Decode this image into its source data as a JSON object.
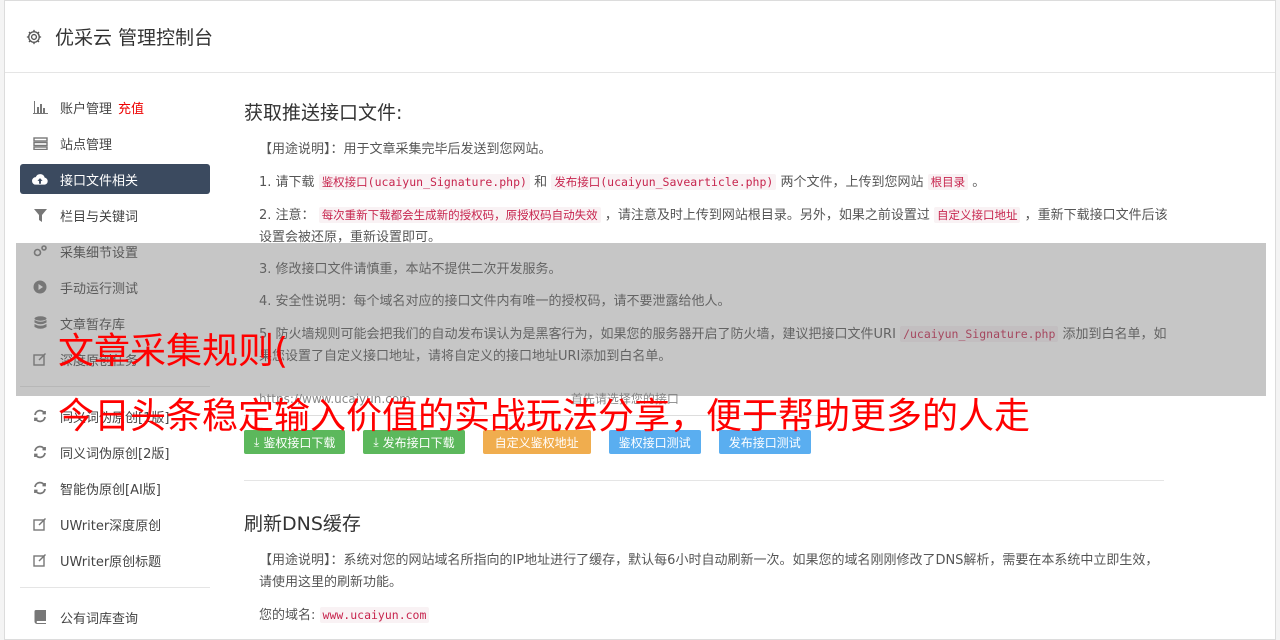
{
  "app": {
    "title": "优采云 管理控制台"
  },
  "sidebar": {
    "items": [
      {
        "label": "账户管理",
        "extra": "充值",
        "icon": "bar-chart-icon"
      },
      {
        "label": "站点管理",
        "icon": "server-icon"
      },
      {
        "label": "接口文件相关",
        "icon": "cloud-upload-icon",
        "active": true
      },
      {
        "label": "栏目与关键词",
        "icon": "filter-icon"
      },
      {
        "label": "采集细节设置",
        "icon": "cogs-icon"
      },
      {
        "label": "手动运行测试",
        "icon": "play-circle-icon"
      },
      {
        "label": "文章暂存库",
        "icon": "database-icon"
      },
      {
        "label": "深度原创任务",
        "icon": "edit-icon"
      },
      {
        "label": "同义词伪原创[1版]",
        "icon": "refresh-icon"
      },
      {
        "label": "同义词伪原创[2版]",
        "icon": "refresh-icon"
      },
      {
        "label": "智能伪原创[AI版]",
        "icon": "refresh-icon"
      },
      {
        "label": "UWriter深度原创",
        "icon": "edit-icon"
      },
      {
        "label": "UWriter原创标题",
        "icon": "edit-icon"
      },
      {
        "label": "公有词库查询",
        "icon": "book-icon"
      }
    ]
  },
  "section1": {
    "title": "获取推送接口文件:",
    "usage": "【用途说明】：用于文章采集完毕后发送到您网站。",
    "step1": {
      "a": "1. 请下载",
      "code1": "鉴权接口(ucaiyun_Signature.php)",
      "b": "和",
      "code2": "发布接口(ucaiyun_Savearticle.php)",
      "c": "两个文件，上传到您网站",
      "code3": "根目录",
      "d": "。"
    },
    "step2": {
      "a": "2. 注意：",
      "code1": "每次重新下载都会生成新的授权码，原授权码自动失效",
      "b": "，请注意及时上传到网站根目录。另外，如果之前设置过",
      "code2": "自定义接口地址",
      "c": "，重新下载接口文件后该设置会被还原，重新设置即可。"
    },
    "step3": "3. 修改接口文件请慎重，本站不提供二次开发服务。",
    "step4": "4. 安全性说明：每个域名对应的接口文件内有唯一的授权码，请不要泄露给他人。",
    "step5": {
      "a": "5. 防火墙规则可能会把我们的自动发布误认为是黑客行为，如果您的服务器开启了防火墙，建议把接口文件URI",
      "code1": "/ucaiyun_Signature.php",
      "b": "添加到白名单，如果您设置了自定义接口地址，请将自定义的接口地址URI添加到白名单。"
    },
    "link": "https://www.ucaiyun.com",
    "link_hint": "首先请选择您的接口",
    "buttons": {
      "dl_auth": "鉴权接口下载",
      "dl_publish": "发布接口下载",
      "custom_auth": "自定义鉴权地址",
      "test_auth": "鉴权接口测试",
      "test_publish": "发布接口测试"
    }
  },
  "section2": {
    "title": "刷新DNS缓存",
    "usage": "【用途说明】：系统对您的网站域名所指向的IP地址进行了缓存，默认每6小时自动刷新一次。如果您的域名刚刚修改了DNS解析，需要在本系统中立即生效，请使用这里的刷新功能。",
    "domain_label": "您的域名:",
    "domain_value": "www.ucaiyun.com"
  },
  "overlay": {
    "line1": "文章采集规则(",
    "line2": "今日头条稳定输入价值的实战玩法分享，便于帮助更多的人走"
  },
  "colors": {
    "nav_active": "#3b4a5f",
    "btn_green": "#5cb85c",
    "btn_orange": "#f0ad4e",
    "btn_blue": "#5aaef0",
    "overlay_text": "#ff0000"
  }
}
